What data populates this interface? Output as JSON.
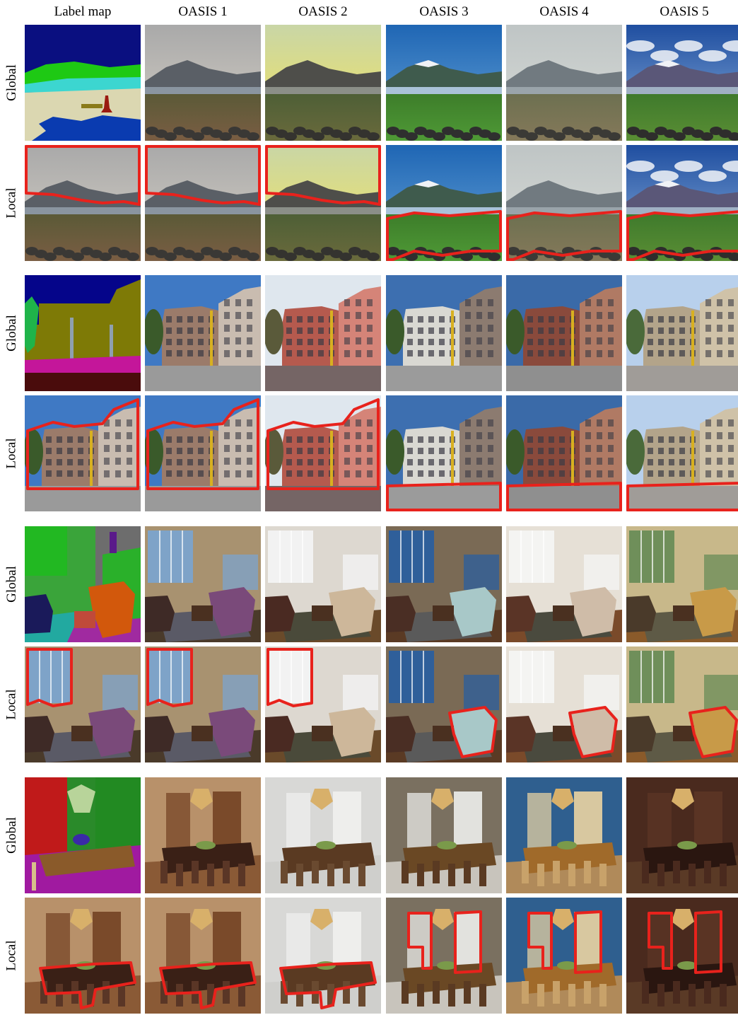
{
  "figure": {
    "columns": [
      "Label map",
      "OASIS 1",
      "OASIS 2",
      "OASIS 3",
      "OASIS 4",
      "OASIS 5"
    ],
    "rows": [
      {
        "label": "Global",
        "scene": "landscape",
        "mode": "global",
        "outline": "none"
      },
      {
        "label": "Local",
        "scene": "landscape",
        "mode": "local",
        "outline": "sky"
      },
      {
        "label": "Global",
        "scene": "street",
        "mode": "global",
        "outline": "none"
      },
      {
        "label": "Local",
        "scene": "street",
        "mode": "local",
        "outline": "building"
      },
      {
        "label": "Global",
        "scene": "living",
        "mode": "global",
        "outline": "none"
      },
      {
        "label": "Local",
        "scene": "living",
        "mode": "local",
        "outline": "window"
      },
      {
        "label": "Global",
        "scene": "dining",
        "mode": "global",
        "outline": "none"
      },
      {
        "label": "Local",
        "scene": "dining",
        "mode": "local",
        "outline": "table"
      }
    ],
    "outline_color": "#e8221c"
  }
}
